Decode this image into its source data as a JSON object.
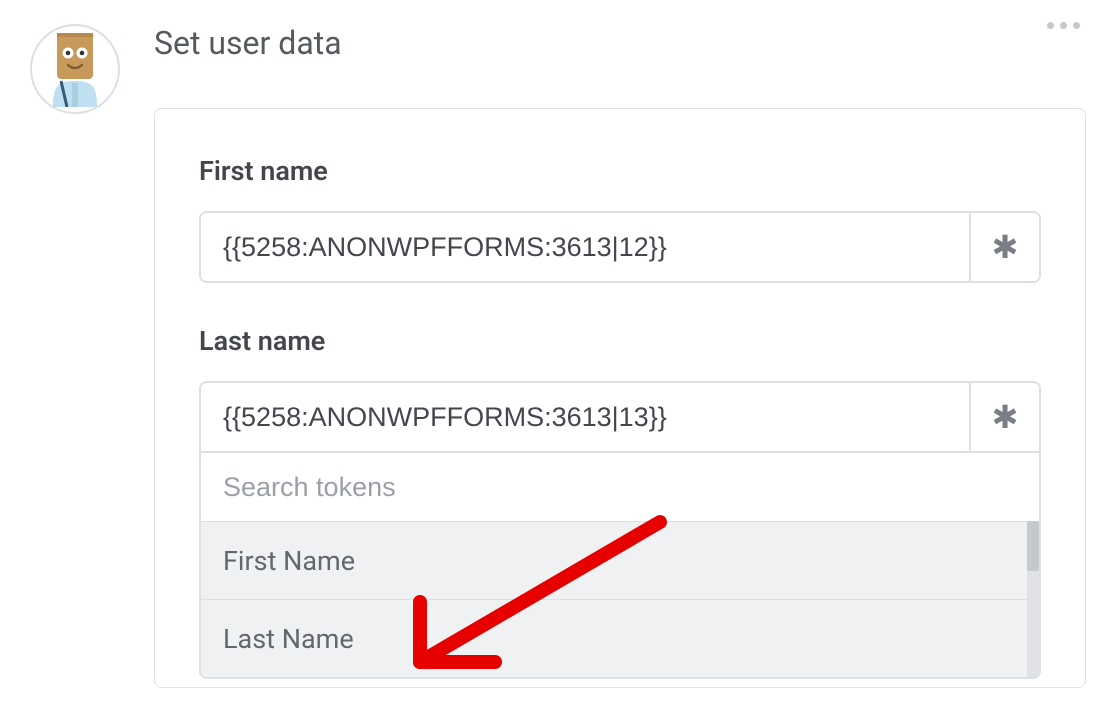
{
  "action": {
    "title": "Set user data"
  },
  "fields": {
    "first_name": {
      "label": "First name",
      "value": "{{5258:ANONWPFFORMS:3613|12}}"
    },
    "last_name": {
      "label": "Last name",
      "value": "{{5258:ANONWPFFORMS:3613|13}}"
    }
  },
  "token_dropdown": {
    "search_placeholder": "Search tokens",
    "options": [
      "First Name",
      "Last Name"
    ]
  },
  "icons": {
    "asterisk": "✱"
  }
}
